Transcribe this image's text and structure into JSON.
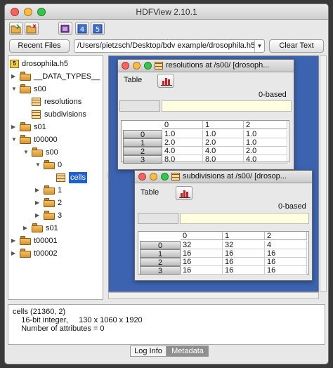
{
  "window": {
    "title": "HDFView 2.10.1"
  },
  "address": {
    "recent_files_label": "Recent Files",
    "path": "/Users/pietzsch/Desktop/bdv example/drosophila.h5",
    "clear_text_label": "Clear Text"
  },
  "tree": {
    "root": "drosophila.h5",
    "data_types": "__DATA_TYPES__",
    "s00": "s00",
    "resolutions": "resolutions",
    "subdivisions": "subdivisions",
    "s01": "s01",
    "t00000": "t00000",
    "t00000_s00": "s00",
    "n0": "0",
    "cells": "cells",
    "n1": "1",
    "n2": "2",
    "n3": "3",
    "t00000_s01": "s01",
    "t00001": "t00001",
    "t00002": "t00002"
  },
  "resolutions_window": {
    "title": "resolutions  at  /s00/  [drosoph...",
    "menu_table": "Table",
    "index_base": "0-based",
    "columns": [
      "0",
      "1",
      "2"
    ],
    "rows": [
      {
        "index": "0",
        "cells": [
          "1.0",
          "1.0",
          "1.0"
        ]
      },
      {
        "index": "1",
        "cells": [
          "2.0",
          "2.0",
          "1.0"
        ]
      },
      {
        "index": "2",
        "cells": [
          "4.0",
          "4.0",
          "2.0"
        ]
      },
      {
        "index": "3",
        "cells": [
          "8.0",
          "8.0",
          "4.0"
        ]
      }
    ]
  },
  "subdivisions_window": {
    "title": "subdivisions  at  /s00/  [drosop...",
    "menu_table": "Table",
    "index_base": "0-based",
    "columns": [
      "0",
      "1",
      "2"
    ],
    "rows": [
      {
        "index": "0",
        "cells": [
          "32",
          "32",
          "4"
        ]
      },
      {
        "index": "1",
        "cells": [
          "16",
          "16",
          "16"
        ]
      },
      {
        "index": "2",
        "cells": [
          "16",
          "16",
          "16"
        ]
      },
      {
        "index": "3",
        "cells": [
          "16",
          "16",
          "16"
        ]
      }
    ]
  },
  "info": {
    "line1": "cells (21360, 2)",
    "line2": "    16-bit integer,     130 x 1060 x 1920",
    "line3": "    Number of attributes = 0"
  },
  "bottom_tabs": {
    "log_info": "Log Info",
    "metadata": "Metadata"
  },
  "colors": {
    "desktop": "#3c63b0",
    "selection": "#1f5fd0",
    "traffic_close": "#fc615d",
    "traffic_min": "#fdbc40",
    "traffic_max": "#34c84a"
  }
}
